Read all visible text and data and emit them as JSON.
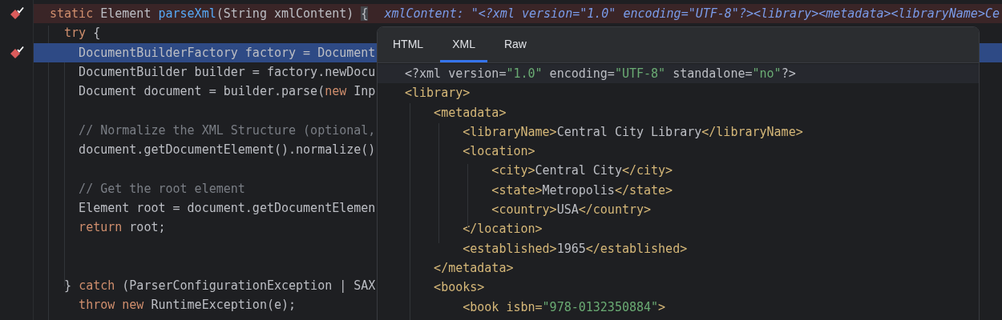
{
  "editor": {
    "lines": [
      {
        "breakpoint": true,
        "current": false,
        "tokens": [
          {
            "kind": "keyword",
            "t": "static"
          },
          {
            "kind": "plain",
            "t": " Element "
          },
          {
            "kind": "method",
            "t": "parseXml"
          },
          {
            "kind": "plain",
            "t": "(String xmlContent) "
          },
          {
            "kind": "brace",
            "t": "{"
          }
        ],
        "hint": "xmlContent: \"<?xml version=\"1.0\" encoding=\"UTF-8\"?><library><metadata><libraryName>Ce"
      },
      {
        "breakpoint": false,
        "current": false,
        "tokens": [
          {
            "kind": "keyword",
            "t": "  try"
          },
          {
            "kind": "plain",
            "t": " {"
          }
        ]
      },
      {
        "breakpoint": true,
        "current": true,
        "tokens": [
          {
            "kind": "plain",
            "t": "    DocumentBuilderFactory factory = Document"
          }
        ]
      },
      {
        "breakpoint": false,
        "current": false,
        "tokens": [
          {
            "kind": "plain",
            "t": "    DocumentBuilder builder = factory.newDocu"
          }
        ]
      },
      {
        "breakpoint": false,
        "current": false,
        "tokens": [
          {
            "kind": "plain",
            "t": "    Document document = builder.parse("
          },
          {
            "kind": "keyword",
            "t": "new"
          },
          {
            "kind": "plain",
            "t": " Inp"
          }
        ]
      },
      {
        "breakpoint": false,
        "current": false
      },
      {
        "breakpoint": false,
        "current": false,
        "tokens": [
          {
            "kind": "comment",
            "t": "    // Normalize the XML Structure (optional,"
          }
        ]
      },
      {
        "breakpoint": false,
        "current": false,
        "tokens": [
          {
            "kind": "plain",
            "t": "    document.getDocumentElement().normalize()"
          }
        ]
      },
      {
        "breakpoint": false,
        "current": false
      },
      {
        "breakpoint": false,
        "current": false,
        "tokens": [
          {
            "kind": "comment",
            "t": "    // Get the root element"
          }
        ]
      },
      {
        "breakpoint": false,
        "current": false,
        "tokens": [
          {
            "kind": "plain",
            "t": "    Element root = document.getDocumentElemen"
          }
        ]
      },
      {
        "breakpoint": false,
        "current": false,
        "tokens": [
          {
            "kind": "keyword",
            "t": "    return"
          },
          {
            "kind": "plain",
            "t": " root;"
          }
        ]
      },
      {
        "breakpoint": false,
        "current": false
      },
      {
        "breakpoint": false,
        "current": false
      },
      {
        "breakpoint": false,
        "current": false,
        "tokens": [
          {
            "kind": "plain",
            "t": "  } "
          },
          {
            "kind": "keyword",
            "t": "catch"
          },
          {
            "kind": "plain",
            "t": " (ParserConfigurationException | SAX"
          }
        ]
      },
      {
        "breakpoint": false,
        "current": false,
        "tokens": [
          {
            "kind": "keyword",
            "t": "    throw new"
          },
          {
            "kind": "plain",
            "t": " RuntimeException(e);"
          }
        ]
      }
    ]
  },
  "popup": {
    "tabs": [
      {
        "label": "HTML",
        "selected": false
      },
      {
        "label": "XML",
        "selected": true
      },
      {
        "label": "Raw",
        "selected": false
      }
    ],
    "lines": [
      {
        "current": true,
        "tokens": [
          {
            "kind": "plain",
            "t": "<?xml version="
          },
          {
            "kind": "value",
            "t": "\"1.0\""
          },
          {
            "kind": "plain",
            "t": " encoding="
          },
          {
            "kind": "value",
            "t": "\"UTF-8\""
          },
          {
            "kind": "plain",
            "t": " standalone="
          },
          {
            "kind": "value",
            "t": "\"no\""
          },
          {
            "kind": "plain",
            "t": "?>"
          }
        ]
      },
      {
        "current": false,
        "tokens": [
          {
            "kind": "tag",
            "t": "<library>"
          }
        ]
      },
      {
        "current": false,
        "tokens": [
          {
            "kind": "tag",
            "t": "    <metadata>"
          }
        ]
      },
      {
        "current": false,
        "tokens": [
          {
            "kind": "tag",
            "t": "        <libraryName>"
          },
          {
            "kind": "plain",
            "t": "Central City Library"
          },
          {
            "kind": "tag",
            "t": "</libraryName>"
          }
        ]
      },
      {
        "current": false,
        "tokens": [
          {
            "kind": "tag",
            "t": "        <location>"
          }
        ]
      },
      {
        "current": false,
        "tokens": [
          {
            "kind": "tag",
            "t": "            <city>"
          },
          {
            "kind": "plain",
            "t": "Central City"
          },
          {
            "kind": "tag",
            "t": "</city>"
          }
        ]
      },
      {
        "current": false,
        "tokens": [
          {
            "kind": "tag",
            "t": "            <state>"
          },
          {
            "kind": "plain",
            "t": "Metropolis"
          },
          {
            "kind": "tag",
            "t": "</state>"
          }
        ]
      },
      {
        "current": false,
        "tokens": [
          {
            "kind": "tag",
            "t": "            <country>"
          },
          {
            "kind": "plain",
            "t": "USA"
          },
          {
            "kind": "tag",
            "t": "</country>"
          }
        ]
      },
      {
        "current": false,
        "tokens": [
          {
            "kind": "tag",
            "t": "        </location>"
          }
        ]
      },
      {
        "current": false,
        "tokens": [
          {
            "kind": "tag",
            "t": "        <established>"
          },
          {
            "kind": "plain",
            "t": "1965"
          },
          {
            "kind": "tag",
            "t": "</established>"
          }
        ]
      },
      {
        "current": false,
        "tokens": [
          {
            "kind": "tag",
            "t": "    </metadata>"
          }
        ]
      },
      {
        "current": false,
        "tokens": [
          {
            "kind": "tag",
            "t": "    <books>"
          }
        ]
      },
      {
        "current": false,
        "tokens": [
          {
            "kind": "tag",
            "t": "        <book isbn="
          },
          {
            "kind": "value",
            "t": "\"978-0132350884\""
          },
          {
            "kind": "tag",
            "t": ">"
          }
        ]
      }
    ]
  }
}
